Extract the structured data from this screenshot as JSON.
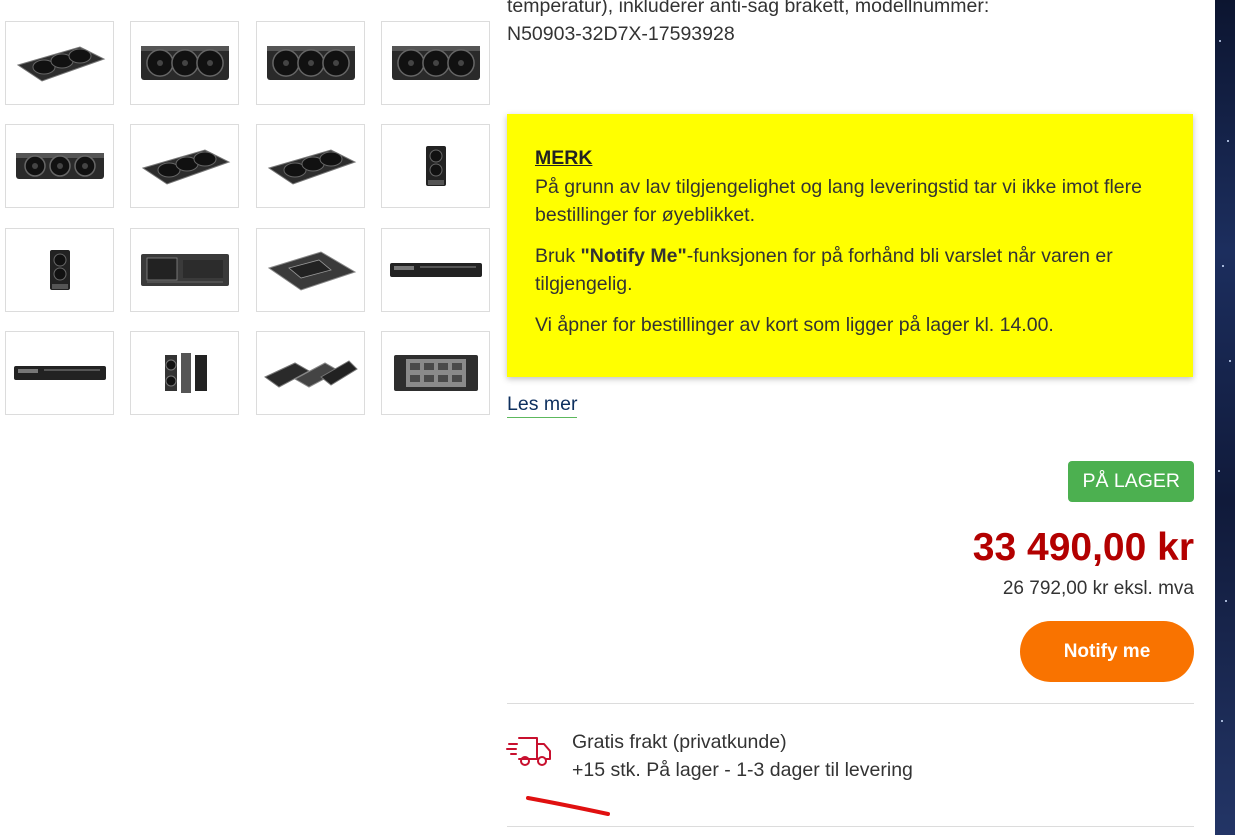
{
  "gallery": {
    "thumbnails": [
      {
        "alt": "card-angled-1"
      },
      {
        "alt": "card-front-1"
      },
      {
        "alt": "card-front-2"
      },
      {
        "alt": "card-front-3"
      },
      {
        "alt": "card-front-flat"
      },
      {
        "alt": "card-angled-2"
      },
      {
        "alt": "card-angled-3"
      },
      {
        "alt": "card-side-vertical"
      },
      {
        "alt": "card-side-vertical-2"
      },
      {
        "alt": "card-back"
      },
      {
        "alt": "card-backplate-angled"
      },
      {
        "alt": "card-top-edge"
      },
      {
        "alt": "card-bottom-edge"
      },
      {
        "alt": "card-exploded-vertical"
      },
      {
        "alt": "card-exploded-angled"
      },
      {
        "alt": "card-bare-pcb"
      }
    ]
  },
  "description": {
    "line1": "temperatur), inkluderer anti-sag brakett, modellnummer:",
    "line2": "N50903-32D7X-17593928"
  },
  "notice": {
    "heading": "MERK",
    "paragraph1": "På grunn av lav tilgjengelighet og lang leveringstid tar vi ikke imot flere bestillinger for øyeblikket.",
    "paragraph2_prefix": "Bruk ",
    "paragraph2_bold": "\"Notify Me\"",
    "paragraph2_suffix": "-funksjonen for på forhånd bli varslet når varen er tilgjengelig.",
    "paragraph3": "Vi åpner for bestillinger av kort som ligger på lager kl. 14.00."
  },
  "read_more": "Les mer",
  "stock_badge": "PÅ LAGER",
  "price": {
    "incl_vat": "33 490,00 kr",
    "excl_vat": "26 792,00 kr eksl. mva"
  },
  "notify_button": "Notify me",
  "shipping": {
    "line1": "Gratis frakt (privatkunde)",
    "line2": "+15 stk. På lager - 1-3 dager til levering"
  },
  "colors": {
    "notice_bg": "#ffff00",
    "price": "#b30000",
    "badge": "#4cb050",
    "notify_button": "#f97300",
    "truck_icon": "#c8102e"
  }
}
